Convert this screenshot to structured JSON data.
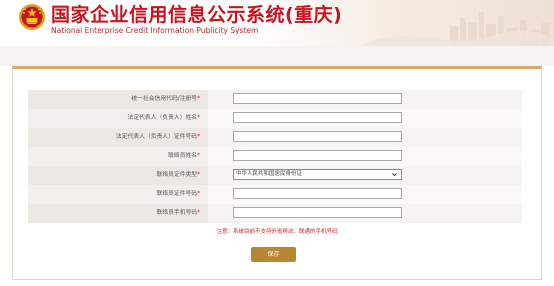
{
  "header": {
    "title_cn": "国家企业信用信息公示系统(重庆)",
    "title_en": "National Enterprise Credit Information Publicity System"
  },
  "form": {
    "rows": [
      {
        "label": "统一社会信用代码/注册号",
        "required": "*",
        "type": "input",
        "value": ""
      },
      {
        "label": "法定代表人（负责人）姓名",
        "required": "*",
        "type": "input",
        "value": ""
      },
      {
        "label": "法定代表人（负责人）证件号码",
        "required": "*",
        "type": "input",
        "value": ""
      },
      {
        "label": "联络员姓名",
        "required": "*",
        "type": "input",
        "value": ""
      },
      {
        "label": "联络员证件类型",
        "required": "*",
        "type": "select",
        "value": "中华人民共和国居民身份证"
      },
      {
        "label": "联络员证件号码",
        "required": "*",
        "type": "input",
        "value": ""
      },
      {
        "label": "联络员手机号码",
        "required": "*",
        "type": "input",
        "value": ""
      }
    ]
  },
  "notice": "注意：系统目前不支持外省移动、联通的手机号码",
  "save_label": "保存",
  "colors": {
    "brand_red": "#c8141e",
    "button_gold": "#b8862f",
    "panel_border": "#d5ac72"
  },
  "icons": {
    "emblem": "national-emblem-icon",
    "dropdown": "chevron-down-icon"
  }
}
